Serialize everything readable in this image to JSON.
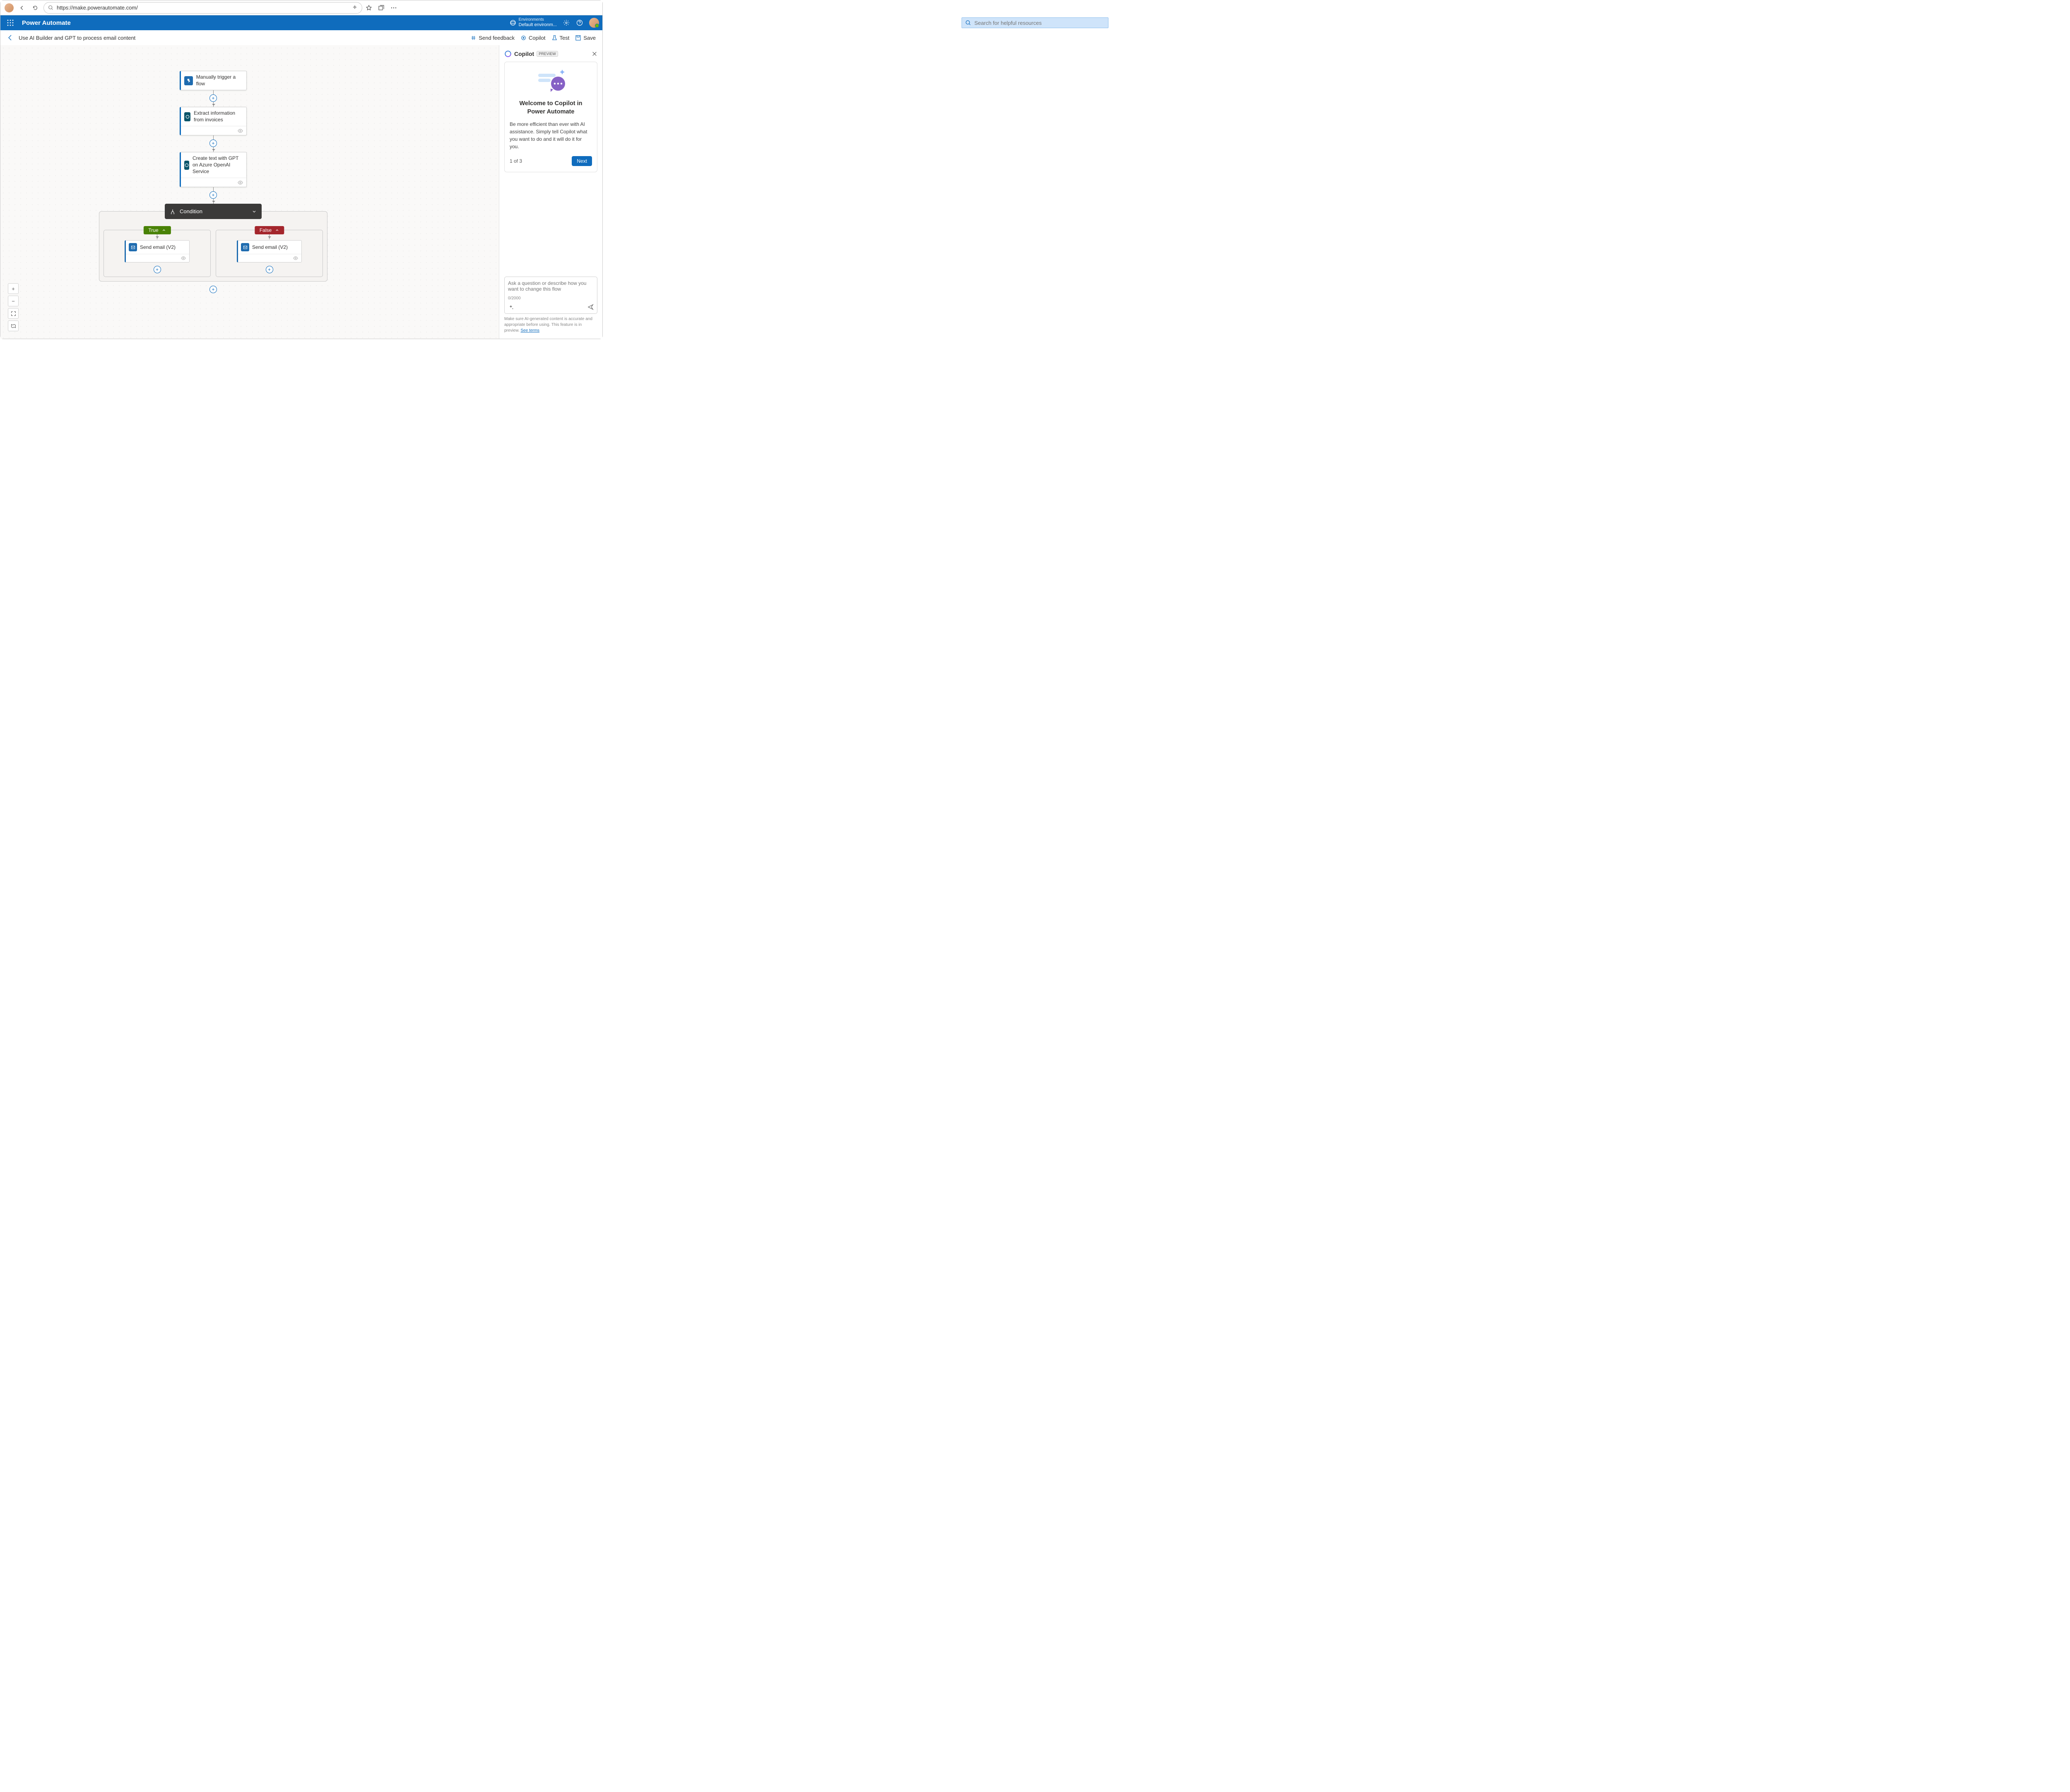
{
  "browser": {
    "url": "https://make.powerautomate.com/"
  },
  "header": {
    "app_title": "Power Automate",
    "search_placeholder": "Search for helpful resources",
    "env_label": "Environments",
    "env_name": "Default environm..."
  },
  "subheader": {
    "flow_title": "Use AI Builder and GPT to process email content",
    "feedback": "Send feedback",
    "copilot": "Copilot",
    "test": "Test",
    "save": "Save"
  },
  "flow": {
    "trigger": "Manually trigger a flow",
    "extract": "Extract information from invoices",
    "gpt": "Create text with GPT on Azure OpenAI Service",
    "condition": "Condition",
    "true_label": "True",
    "false_label": "False",
    "send_email": "Send email (V2)"
  },
  "copilot": {
    "title": "Copilot",
    "preview": "PREVIEW",
    "welcome_h": "Welcome to Copilot in Power Automate",
    "welcome_p": "Be more efficient than ever with AI assistance. Simply tell Copilot what you want to do and it will do it for you.",
    "step": "1 of 3",
    "next": "Next",
    "input_placeholder": "Ask a question or describe how you want to change this flow",
    "count": "0/2000",
    "footer_text": "Make sure AI-generated content is accurate and appropriate before using. This feature is in preview. ",
    "footer_link": "See terms"
  }
}
